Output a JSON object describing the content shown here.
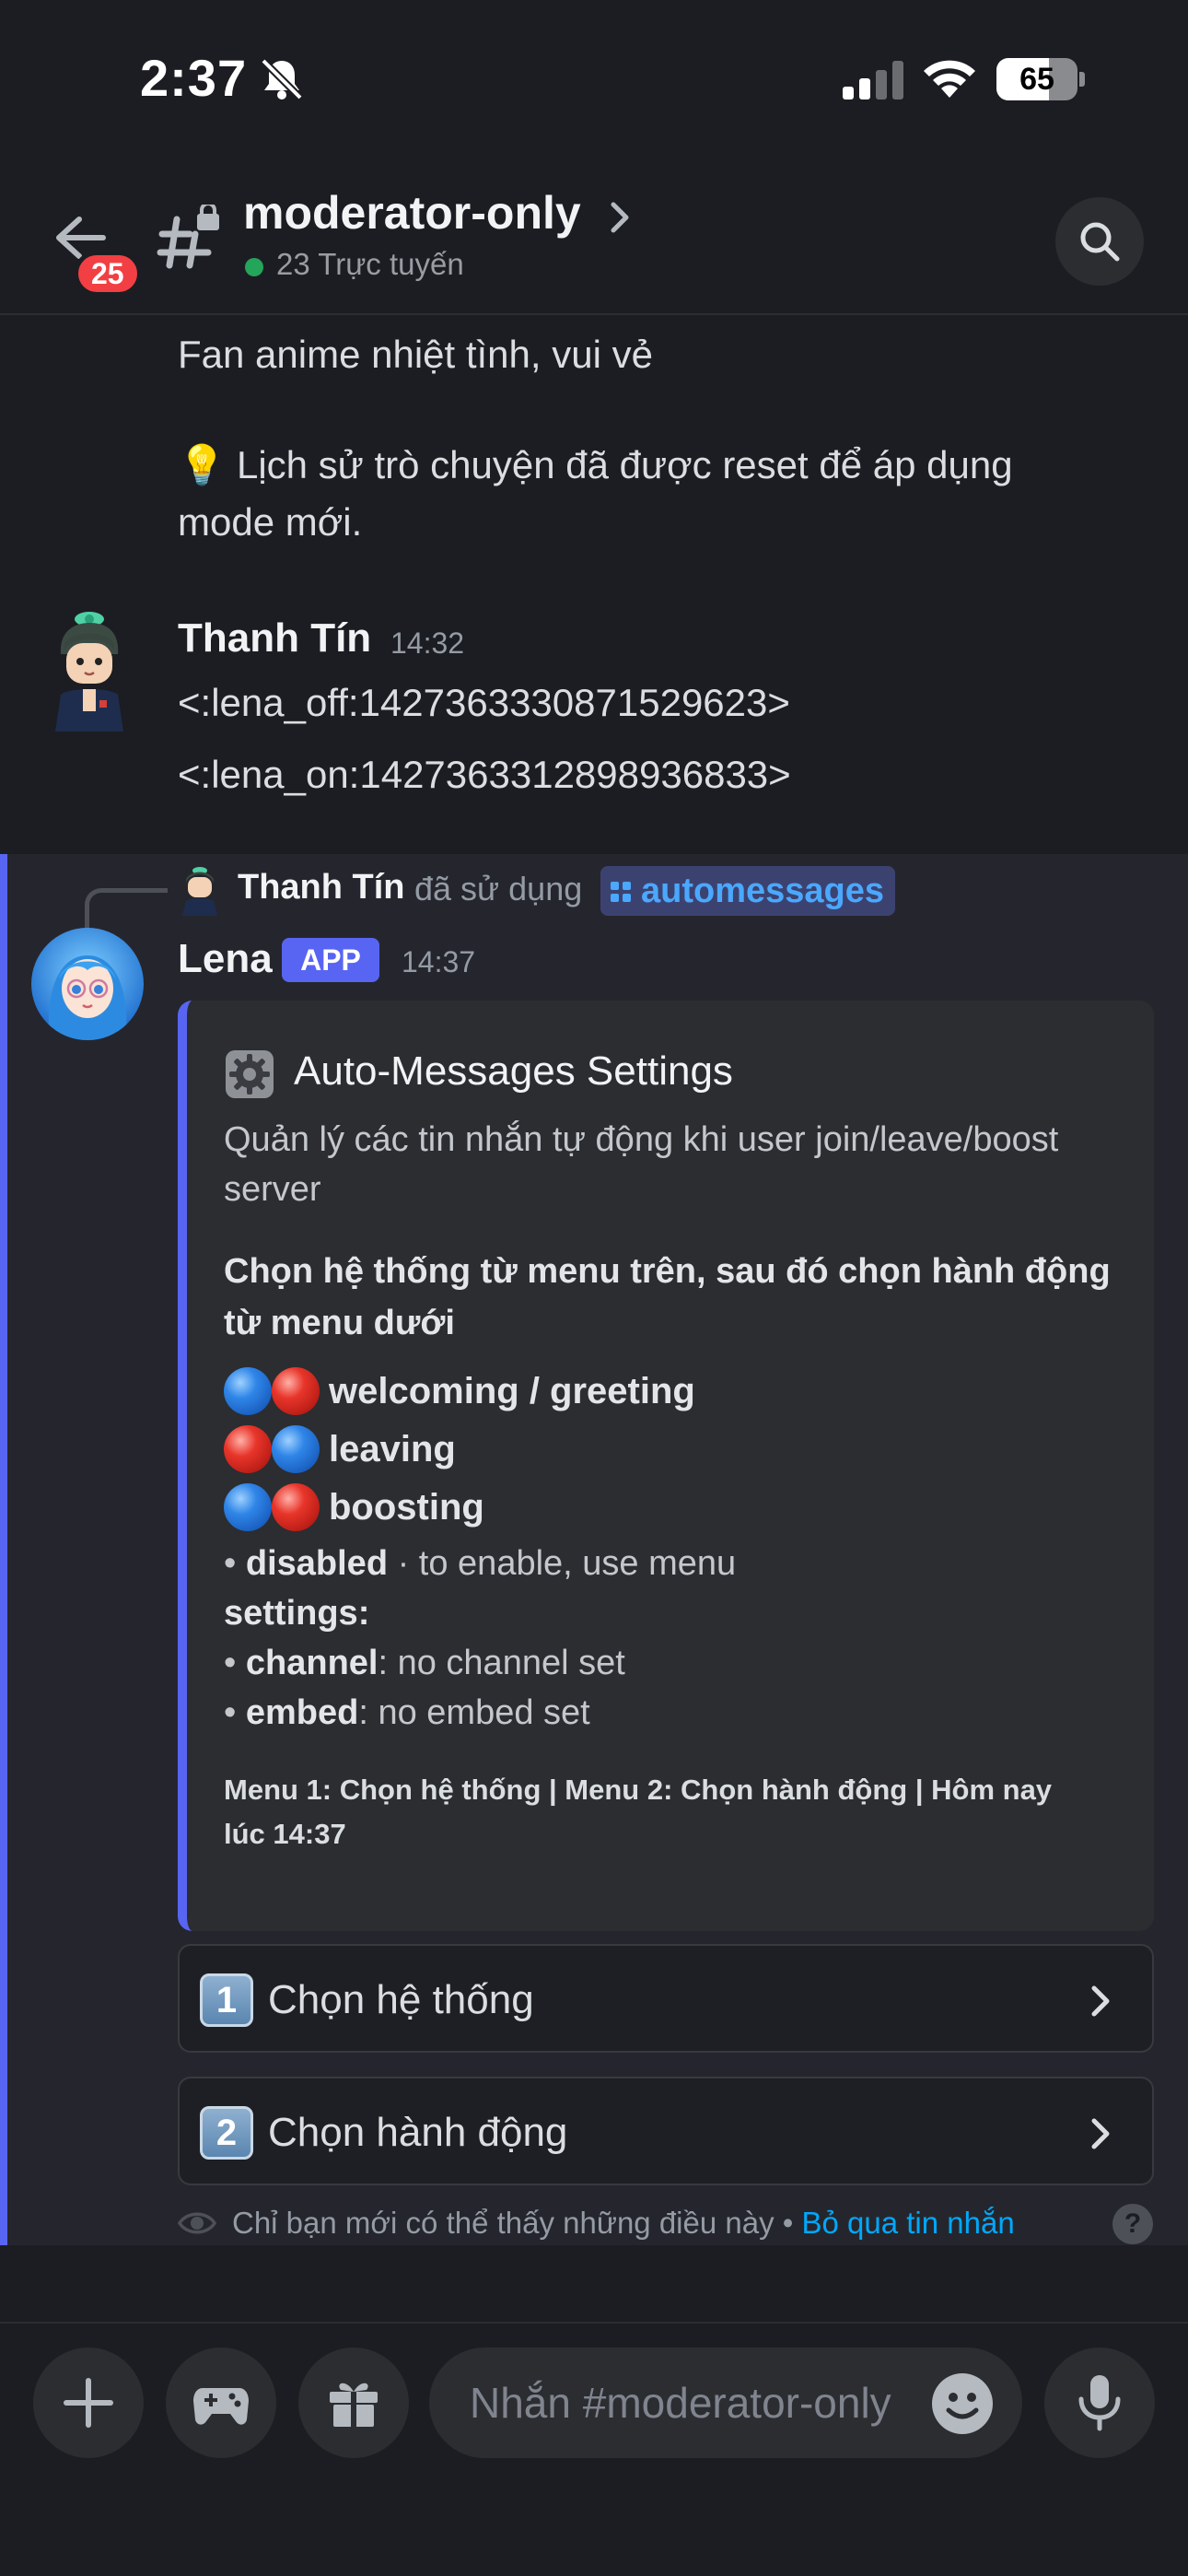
{
  "status_bar": {
    "time": "2:37",
    "battery": "65",
    "battery_level": 0.65
  },
  "header": {
    "back_badge": "25",
    "channel_name": "moderator-only",
    "online_text": "23 Trực tuyến"
  },
  "messages": {
    "previous_lines": [
      "Fan anime nhiệt tình, vui vẻ",
      "💡 Lịch sử trò chuyện đã được reset để áp dụng",
      "mode mới."
    ],
    "tin": {
      "author": "Thanh Tín",
      "time": "14:32",
      "line1": "<:lena_off:1427363330871529623>",
      "line2": "<:lena_on:1427363312898936833>"
    },
    "lena": {
      "used_by": "Thanh Tín",
      "used_text": "đã sử dụng",
      "command": "automessages",
      "author": "Lena",
      "app_tag": "APP",
      "time": "14:37",
      "embed": {
        "title_icon": "gear-emoji",
        "title": "Auto-Messages Settings",
        "desc_line1": "Quản lý các tin nhắn tự động khi user join/leave/boost",
        "desc_line2": "server",
        "instruction_line1": "Chọn hệ thống từ menu trên, sau đó chọn hành động",
        "instruction_line2": "từ menu dưới",
        "systems": [
          {
            "label": "welcoming / greeting"
          },
          {
            "label": "leaving"
          },
          {
            "label": "boosting"
          }
        ],
        "status_bold": "disabled",
        "status_rest": " · to enable, use menu",
        "settings_label": "settings:",
        "channel_key": "channel",
        "channel_value": ": no channel set",
        "embed_key": "embed",
        "embed_value": ": no embed set",
        "footer_line1": "Menu 1: Chọn hệ thống | Menu 2: Chọn hành động | Hôm nay",
        "footer_line2": "lúc 14:37"
      },
      "menus": [
        {
          "key": "1",
          "label": "Chọn hệ thống"
        },
        {
          "key": "2",
          "label": "Chọn hành động"
        }
      ],
      "ephemeral_note": "Chỉ bạn mới có thể thấy những điều này",
      "ephemeral_sep": " • ",
      "dismiss_link": "Bỏ qua tin nhắn",
      "help": "?"
    }
  },
  "composer": {
    "placeholder": "Nhắn #moderator-only"
  },
  "colors": {
    "accent": "#5865f2",
    "online": "#23a55a",
    "badge": "#f23f43",
    "link": "#00a8fc"
  }
}
